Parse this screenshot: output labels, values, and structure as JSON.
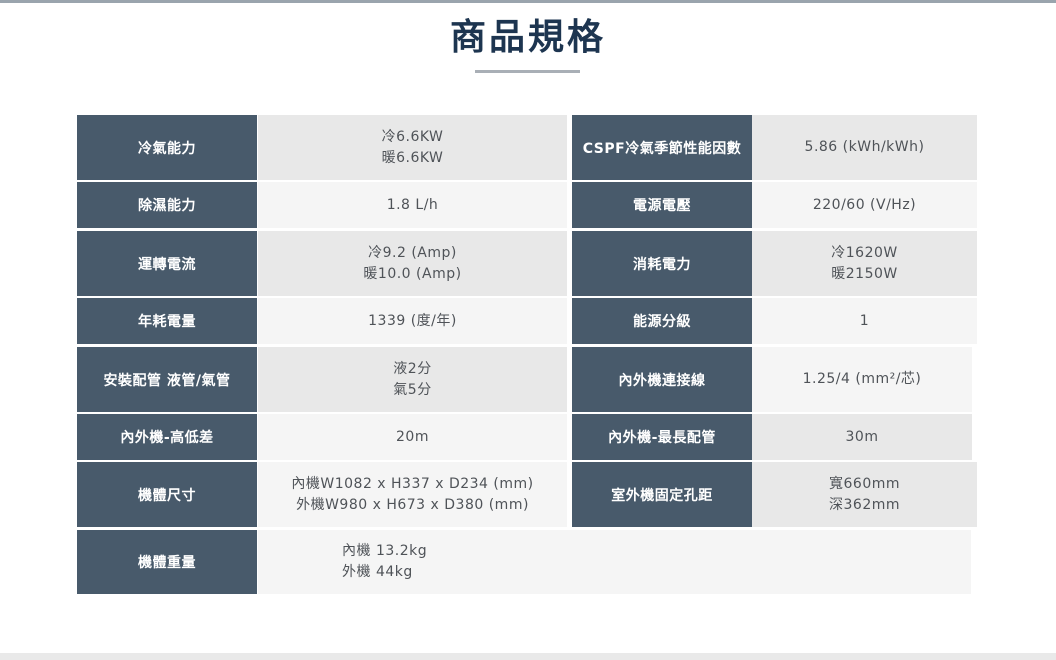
{
  "page": {
    "title": "商品規格"
  },
  "specs": {
    "r1": {
      "l1": "冷氣能力",
      "v1a": "冷6.6KW",
      "v1b": "暖6.6KW",
      "l2": "CSPF冷氣季節性能因數",
      "v2a": "5.86 (kWh/kWh)"
    },
    "r2": {
      "l1": "除濕能力",
      "v1a": "1.8 L/h",
      "l2": "電源電壓",
      "v2a": "220/60 (V/Hz)"
    },
    "r3": {
      "l1": "運轉電流",
      "v1a": "冷9.2 (Amp)",
      "v1b": "暖10.0 (Amp)",
      "l2": "消耗電力",
      "v2a": "冷1620W",
      "v2b": "暖2150W"
    },
    "r4": {
      "l1": "年耗電量",
      "v1a": "1339 (度/年)",
      "l2": "能源分級",
      "v2a": "1"
    },
    "r5": {
      "l1": "安裝配管 液管/氣管",
      "v1a": "液2分",
      "v1b": "氣5分",
      "l2": "內外機連接線",
      "v2a": "1.25/4 (mm²/芯)"
    },
    "r6": {
      "l1": "內外機-高低差",
      "v1a": "20m",
      "l2": "內外機-最長配管",
      "v2a": "30m"
    },
    "r7": {
      "l1": "機體尺寸",
      "v1a": "內機W1082 x H337 x D234 (mm)",
      "v1b": "外機W980 x H673 x D380 (mm)",
      "l2": "室外機固定孔距",
      "v2a": "寬660mm",
      "v2b": "深362mm"
    },
    "r8": {
      "l1": "機體重量",
      "v1a": "內機 13.2kg",
      "v1b": "外機 44kg"
    }
  }
}
